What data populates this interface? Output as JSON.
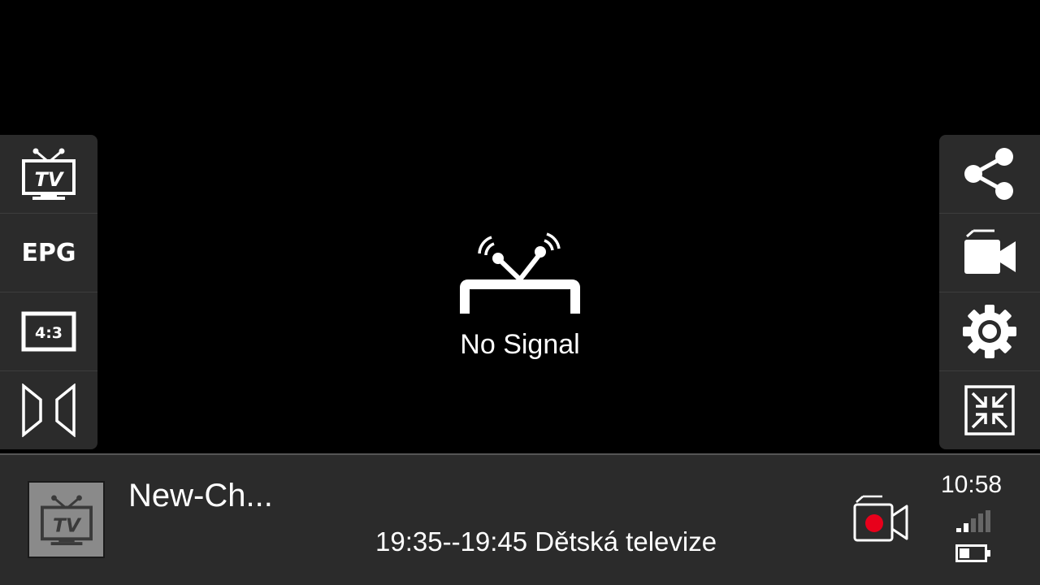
{
  "left_panel": {
    "items": [
      {
        "icon": "tv-icon",
        "label": "TV"
      },
      {
        "icon": "epg-icon",
        "label": "EPG"
      },
      {
        "icon": "aspect-ratio-icon",
        "label": "4:3"
      },
      {
        "icon": "stretch-icon",
        "label": ""
      }
    ]
  },
  "right_panel": {
    "items": [
      {
        "icon": "share-icon"
      },
      {
        "icon": "camera-icon"
      },
      {
        "icon": "settings-icon"
      },
      {
        "icon": "fullscreen-exit-icon"
      }
    ]
  },
  "center": {
    "icon": "antenna-icon",
    "message": "No Signal"
  },
  "bottom_bar": {
    "channel_logo_icon": "tv-icon",
    "channel_name": "New-Ch...",
    "program": "19:35--19:45 Dětská televize",
    "record_icon": "record-camera-icon",
    "time": "10:58",
    "signal_icon": "signal-strength-icon",
    "battery_icon": "battery-icon"
  },
  "colors": {
    "background": "#000000",
    "panel": "#2b2b2b",
    "record_dot": "#e8001b",
    "icon": "#ffffff"
  }
}
